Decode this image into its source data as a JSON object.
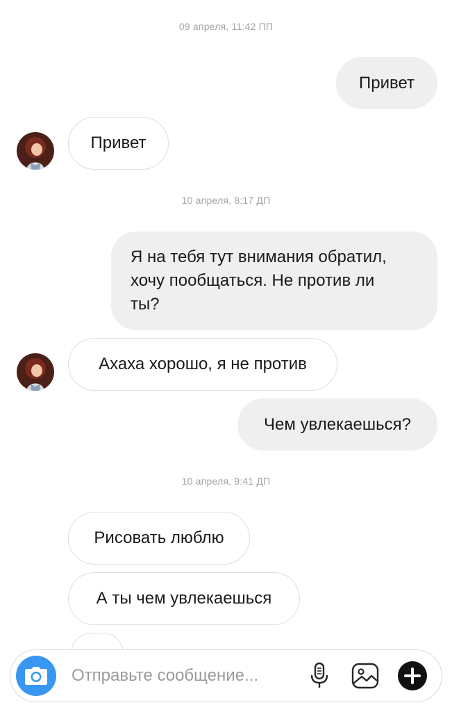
{
  "thread": {
    "stamps": [
      "09 апреля, 11:42 ПП",
      "10 апреля, 8:17 ДП",
      "10 апреля, 9:41 ДП"
    ],
    "messages": [
      {
        "dir": "out",
        "text": "Привет"
      },
      {
        "dir": "in",
        "text": "Привет"
      },
      {
        "dir": "out",
        "lines": [
          "Я на тебя тут внимания обратил,",
          "хочу пообщаться. Не против ли",
          "ты?"
        ]
      },
      {
        "dir": "in",
        "text": "Ахаха хорошо, я не против"
      },
      {
        "dir": "out",
        "text": "Чем увлекаешься?"
      },
      {
        "dir": "in",
        "text": "Рисовать люблю"
      },
      {
        "dir": "in",
        "text": "А ты чем увлекаешься"
      }
    ]
  },
  "composer": {
    "placeholder": "Отправьте сообщение...",
    "icons": [
      "camera-icon",
      "microphone-icon",
      "gallery-icon",
      "plus-icon"
    ]
  },
  "colors": {
    "accent": "#3897f0",
    "bubble_out": "#efefef",
    "bubble_in_border": "#dedede",
    "timestamp": "#a3a3a3"
  }
}
